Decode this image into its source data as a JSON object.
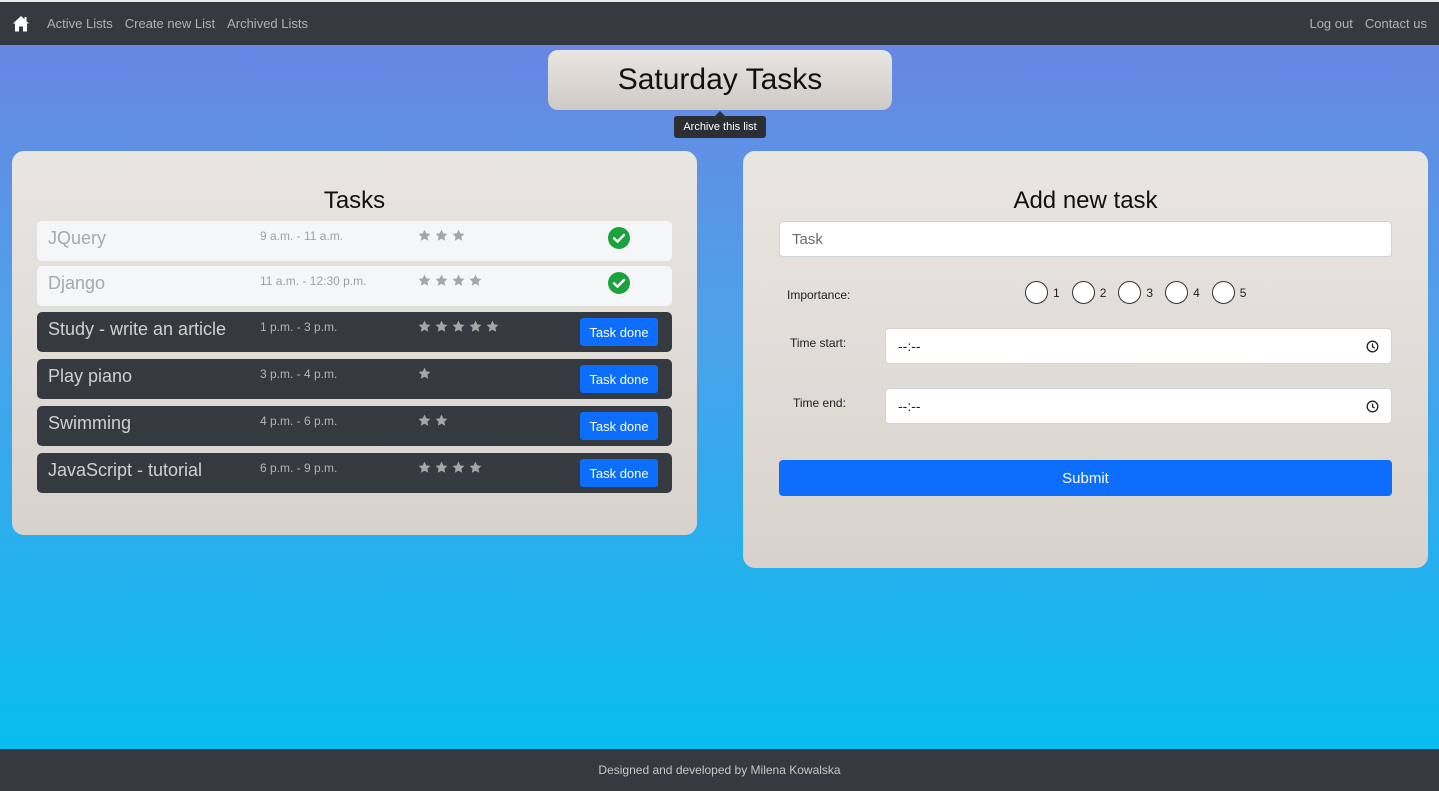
{
  "nav": {
    "home_icon": "home-icon",
    "links": [
      "Active Lists",
      "Create new List",
      "Archived Lists"
    ],
    "right_links": [
      "Log out",
      "Contact us"
    ]
  },
  "list": {
    "title": "Saturday Tasks",
    "archive_tooltip": "Archive this list"
  },
  "tasks_panel": {
    "heading": "Tasks",
    "done_button_label": "Task done",
    "tasks": [
      {
        "name": "JQuery",
        "time": "9 a.m. - 11 a.m.",
        "importance": 3,
        "done": true
      },
      {
        "name": "Django",
        "time": "11 a.m. - 12:30 p.m.",
        "importance": 4,
        "done": true
      },
      {
        "name": "Study - write an article",
        "time": "1 p.m. - 3 p.m.",
        "importance": 5,
        "done": false
      },
      {
        "name": "Play piano",
        "time": "3 p.m. - 4 p.m.",
        "importance": 1,
        "done": false
      },
      {
        "name": "Swimming",
        "time": "4 p.m. - 6 p.m.",
        "importance": 2,
        "done": false
      },
      {
        "name": "JavaScript - tutorial",
        "time": "6 p.m. - 9 p.m.",
        "importance": 4,
        "done": false
      }
    ]
  },
  "add_panel": {
    "heading": "Add new task",
    "task_placeholder": "Task",
    "importance_label": "Importance:",
    "importance_options": [
      "1",
      "2",
      "3",
      "4",
      "5"
    ],
    "time_start_label": "Time start:",
    "time_start_value": "--:--",
    "time_end_label": "Time end:",
    "time_end_value": "--:--",
    "submit_label": "Submit"
  },
  "footer": {
    "text": "Designed and developed by Milena Kowalska"
  },
  "colors": {
    "navbar": "#343a40",
    "primary": "#0d6efd",
    "check": "#1aa33c"
  }
}
